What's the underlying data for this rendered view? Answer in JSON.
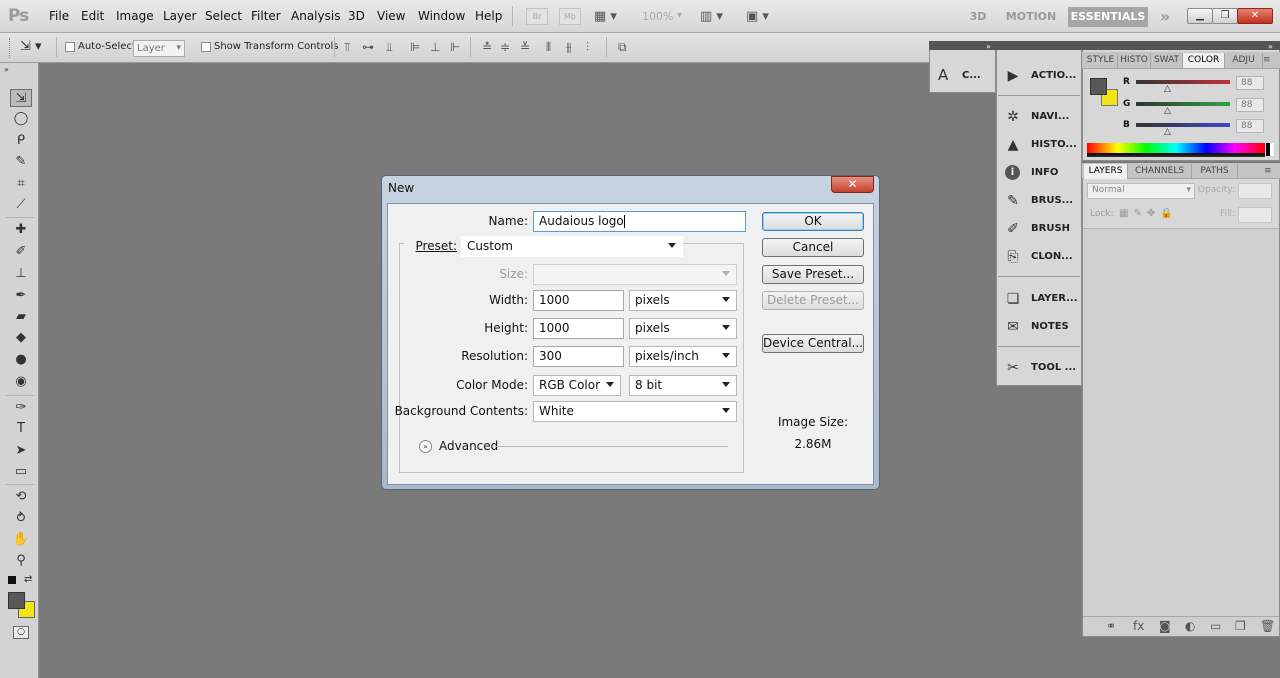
{
  "app": {
    "logo": "Ps"
  },
  "menu": [
    "File",
    "Edit",
    "Image",
    "Layer",
    "Select",
    "Filter",
    "Analysis",
    "3D",
    "View",
    "Window",
    "Help"
  ],
  "appbar": {
    "br": "Br",
    "mb": "Mb",
    "zoom": "100%"
  },
  "workspaces": {
    "w3d": "3D",
    "motion": "MOTION",
    "essentials": "ESSENTIALS",
    "more": "»"
  },
  "options": {
    "auto_select": "Auto-Select:",
    "layer_value": "Layer",
    "transform": "Show Transform Controls"
  },
  "dock_narrow": {
    "char_label": "C..."
  },
  "dock": {
    "group1": [
      {
        "icon": "▶",
        "label": "ACTIO..."
      }
    ],
    "group2": [
      {
        "icon": "✲",
        "label": "NAVI..."
      },
      {
        "icon": "▲",
        "label": "HISTO..."
      },
      {
        "icon": "i",
        "label": "INFO"
      },
      {
        "icon": "✎",
        "label": "BRUS..."
      },
      {
        "icon": "✐",
        "label": "BRUSH"
      },
      {
        "icon": "⎘",
        "label": "CLON..."
      }
    ],
    "group3": [
      {
        "icon": "❏",
        "label": "LAYER..."
      },
      {
        "icon": "✉",
        "label": "NOTES"
      }
    ],
    "group4": [
      {
        "icon": "✂",
        "label": "TOOL ..."
      }
    ]
  },
  "color_panel": {
    "tabs": [
      "STYLE",
      "HISTO",
      "SWAT",
      "COLOR",
      "ADJU"
    ],
    "sliders": [
      {
        "label": "R",
        "value": "88",
        "color": "#c0333a"
      },
      {
        "label": "G",
        "value": "88",
        "color": "#2fa344"
      },
      {
        "label": "B",
        "value": "88",
        "color": "#3b49c4"
      }
    ],
    "fg": "#585858",
    "bg": "#f3e417"
  },
  "layers_panel": {
    "tabs": [
      "LAYERS",
      "CHANNELS",
      "PATHS"
    ],
    "blend_mode": "Normal",
    "opacity_label": "Opacity:",
    "lock_label": "Lock:",
    "fill_label": "Fill:"
  },
  "dialog": {
    "title": "New",
    "close": "✕",
    "name_label": "Name:",
    "name_value": "Audaious logo",
    "preset_label": "Preset:",
    "preset_value": "Custom",
    "size_label": "Size:",
    "width_label": "Width:",
    "width_value": "1000",
    "width_unit": "pixels",
    "height_label": "Height:",
    "height_value": "1000",
    "height_unit": "pixels",
    "resolution_label": "Resolution:",
    "resolution_value": "300",
    "resolution_unit": "pixels/inch",
    "colormode_label": "Color Mode:",
    "colormode_value": "RGB Color",
    "bitdepth_value": "8 bit",
    "background_label": "Background Contents:",
    "background_value": "White",
    "advanced_label": "Advanced",
    "ok": "OK",
    "cancel": "Cancel",
    "save_preset": "Save Preset...",
    "delete_preset": "Delete Preset...",
    "device_central": "Device Central...",
    "image_size_label": "Image Size:",
    "image_size_value": "2.86M"
  }
}
